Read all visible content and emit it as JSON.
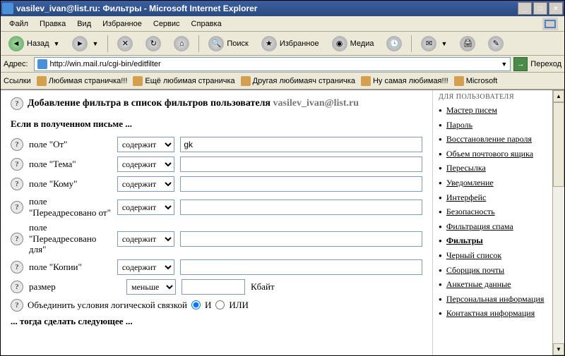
{
  "window": {
    "title": "vasilev_ivan@list.ru: Фильтры - Microsoft Internet Explorer"
  },
  "menu": {
    "file": "Файл",
    "edit": "Правка",
    "view": "Вид",
    "favorites": "Избранное",
    "tools": "Сервис",
    "help": "Справка"
  },
  "toolbar": {
    "back": "Назад",
    "search": "Поиск",
    "favorites": "Избранное",
    "media": "Медиа"
  },
  "address": {
    "label": "Адрес:",
    "url": "http://win.mail.ru/cgi-bin/editfilter",
    "go": "Переход"
  },
  "links": {
    "label": "Ссылки",
    "items": [
      "Любимая страничка!!!",
      "Ещё любимая страничка",
      "Другая любимаяч страничка",
      "Ну самая любимая!!!",
      "Microsoft"
    ]
  },
  "page": {
    "title_prefix": "Добавление фильтра в список фильтров пользователя",
    "email": "vasilev_ivan@list.ru",
    "section": "Если в полученном письме ...",
    "rows": [
      {
        "label": "поле \"От\"",
        "op": "содержит",
        "val": "gk"
      },
      {
        "label": "поле \"Тема\"",
        "op": "содержит",
        "val": ""
      },
      {
        "label": "поле \"Кому\"",
        "op": "содержит",
        "val": ""
      },
      {
        "label": "поле \"Переадресовано от\"",
        "op": "содержит",
        "val": ""
      },
      {
        "label": "поле \"Переадресовано для\"",
        "op": "содержит",
        "val": ""
      },
      {
        "label": "поле \"Копии\"",
        "op": "содержит",
        "val": ""
      }
    ],
    "size_label": "размер",
    "size_op": "меньше",
    "size_unit": "Кбайт",
    "combine_label": "Объединить условия логической связкой",
    "and": "И",
    "or": "ИЛИ",
    "then": "... тогда сделать следующее ..."
  },
  "sidebar": {
    "header": "ДЛЯ ПОЛЬЗОВАТЕЛЯ",
    "items": [
      {
        "label": "Мастер писем"
      },
      {
        "label": "Пароль"
      },
      {
        "label": "Восстановление пароля"
      },
      {
        "label": "Объем почтового ящика"
      },
      {
        "label": "Пересылка"
      },
      {
        "label": "Уведомление"
      },
      {
        "label": "Интерфейс"
      },
      {
        "label": "Безопасность"
      },
      {
        "label": "Фильтрация спама"
      },
      {
        "label": "Фильтры",
        "active": true
      },
      {
        "label": "Черный список"
      },
      {
        "label": "Сборщик почты"
      },
      {
        "label": "Анкетные данные"
      },
      {
        "label": "Персональная информация"
      },
      {
        "label": "Контактная информация"
      }
    ]
  }
}
